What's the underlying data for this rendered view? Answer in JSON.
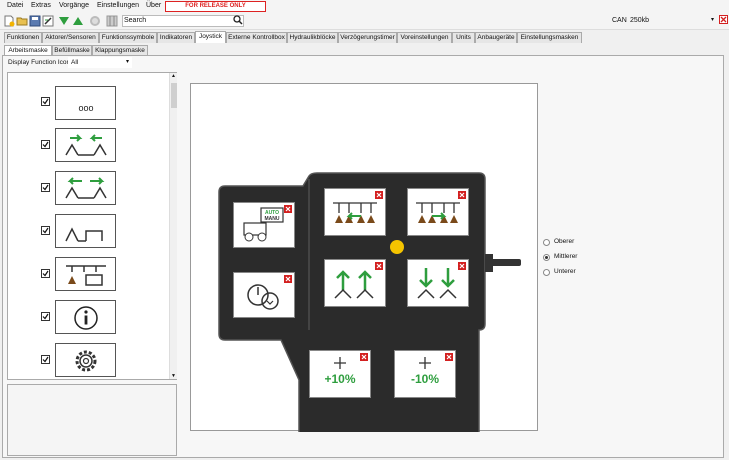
{
  "menu": [
    "Datei",
    "Extras",
    "Vorgänge",
    "Einstellungen",
    "Über"
  ],
  "release_label": "FOR RELEASE ONLY",
  "search": {
    "label": "Search"
  },
  "can": {
    "label": "CAN",
    "value": "250kb"
  },
  "tabs": [
    "Funktionen",
    "Aktorer/Sensoren",
    "Funktionssymbole",
    "Indikatoren",
    "Joystick",
    "Externe Kontrollbox",
    "Hydraulikblöcke",
    "Verzögerungstimer",
    "Voreinstellungen",
    "Units",
    "Anbaugeräte",
    "Einstellungsmasken"
  ],
  "active_tab": "Joystick",
  "subtabs": [
    "Arbeitsmaske",
    "Befüllmaske",
    "Klappungsmaske"
  ],
  "display_function_icons": {
    "label": "Display Function Icons",
    "value": "All"
  },
  "icon_list": [
    {
      "icon": "more-dots-icon",
      "checked": true,
      "text": "ooo"
    },
    {
      "icon": "wings-fold-in-icon",
      "checked": true
    },
    {
      "icon": "wings-fold-out-icon",
      "checked": true
    },
    {
      "icon": "wing-lift-icon",
      "checked": true
    },
    {
      "icon": "section-control-icon",
      "checked": true
    },
    {
      "icon": "info-icon",
      "checked": true
    },
    {
      "icon": "settings-gear-icon",
      "checked": true
    }
  ],
  "joystick": {
    "left_buttons": [
      {
        "icon": "auto-manual-icon",
        "text": [
          "AUTO",
          "MANU"
        ]
      },
      {
        "icon": "power-cycle-icon"
      }
    ],
    "grid_buttons": [
      {
        "icon": "boom-left-icon"
      },
      {
        "icon": "boom-right-icon"
      },
      {
        "icon": "boom-raise-icon"
      },
      {
        "icon": "boom-lower-icon"
      }
    ],
    "bottom_buttons": [
      {
        "icon": "rate-plus-icon",
        "text": "+10%"
      },
      {
        "icon": "rate-minus-icon",
        "text": "-10%"
      }
    ],
    "indicator_color": "#f5c400"
  },
  "layer_options": [
    "Oberer",
    "Mittlerer",
    "Unterer"
  ],
  "layer_selected": "Mittlerer",
  "colors": {
    "green": "#2e9e3e",
    "close_red": "#d32020",
    "body": "#2b2b2b",
    "release_red": "#d22222"
  }
}
